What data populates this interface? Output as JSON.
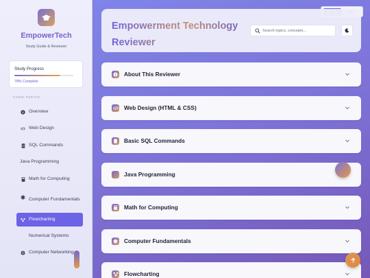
{
  "sidebar": {
    "brand": "EmpowerTech",
    "subtitle": "Study Guide & Reviewer",
    "progress": {
      "title": "Study Progress",
      "value_percent": 78,
      "label": "78% Complete"
    },
    "section_label": "CORE TOPICS",
    "items": [
      {
        "label": "Overview",
        "icon": "info-icon",
        "active": false
      },
      {
        "label": "Web Design",
        "icon": "code-icon",
        "active": false
      },
      {
        "label": "SQL Commands",
        "icon": "database-icon",
        "active": false
      },
      {
        "label": "Java Programming",
        "icon": "",
        "active": false
      },
      {
        "label": "Math for Computing",
        "icon": "calculator-icon",
        "active": false
      },
      {
        "label": "Computer Fundamentals",
        "icon": "chip-icon",
        "active": false
      },
      {
        "label": "Flowcharting",
        "icon": "flowchart-icon",
        "active": true
      },
      {
        "label": "Numerical Systems",
        "icon": "",
        "active": false
      },
      {
        "label": "Computer Networking",
        "icon": "network-icon",
        "active": false
      }
    ]
  },
  "language": {
    "options": [
      "EN",
      "TL"
    ],
    "selected": "EN"
  },
  "header": {
    "title": "Empowerment Technology Reviewer",
    "search_placeholder": "Search topics, concepts...",
    "theme_icon": "moon-icon"
  },
  "accordion": [
    {
      "label": "About This Reviewer",
      "icon": "info-icon"
    },
    {
      "label": "Web Design (HTML & CSS)",
      "icon": "code-icon"
    },
    {
      "label": "Basic SQL Commands",
      "icon": "database-icon"
    },
    {
      "label": "Java Programming",
      "icon": "java-icon"
    },
    {
      "label": "Math for Computing",
      "icon": "calculator-icon"
    },
    {
      "label": "Computer Fundamentals",
      "icon": "chip-icon"
    },
    {
      "label": "Flowcharting",
      "icon": "flowchart-icon"
    }
  ],
  "colors": {
    "accent": "#6c63e6",
    "brand_gradient_start": "#7a6fd0",
    "brand_gradient_end": "#e5a14a"
  }
}
